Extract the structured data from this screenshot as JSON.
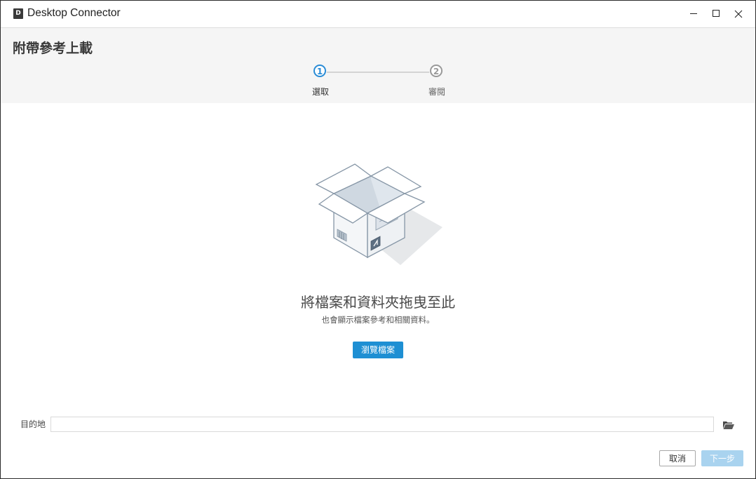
{
  "window": {
    "app_icon_letter": "D",
    "title": "Desktop Connector"
  },
  "header": {
    "title": "附帶參考上載",
    "steps": [
      {
        "number": "1",
        "label": "選取",
        "state": "active"
      },
      {
        "number": "2",
        "label": "審閱",
        "state": "inactive"
      }
    ]
  },
  "dropzone": {
    "title": "將檔案和資料夾拖曳至此",
    "subtitle": "也會顯示檔案參考和相關資料。",
    "browse_label": "瀏覽檔案",
    "illustration_icon": "open-box-icon"
  },
  "destination": {
    "label": "目的地",
    "value": "",
    "browse_icon": "folder-open-icon"
  },
  "footer": {
    "cancel_label": "取消",
    "next_label": "下一步",
    "next_enabled": false
  },
  "colors": {
    "accent": "#1e8fd3",
    "step_active": "#2a8cd6",
    "next_disabled": "#a9d3ef",
    "header_bg": "#f5f5f5"
  }
}
